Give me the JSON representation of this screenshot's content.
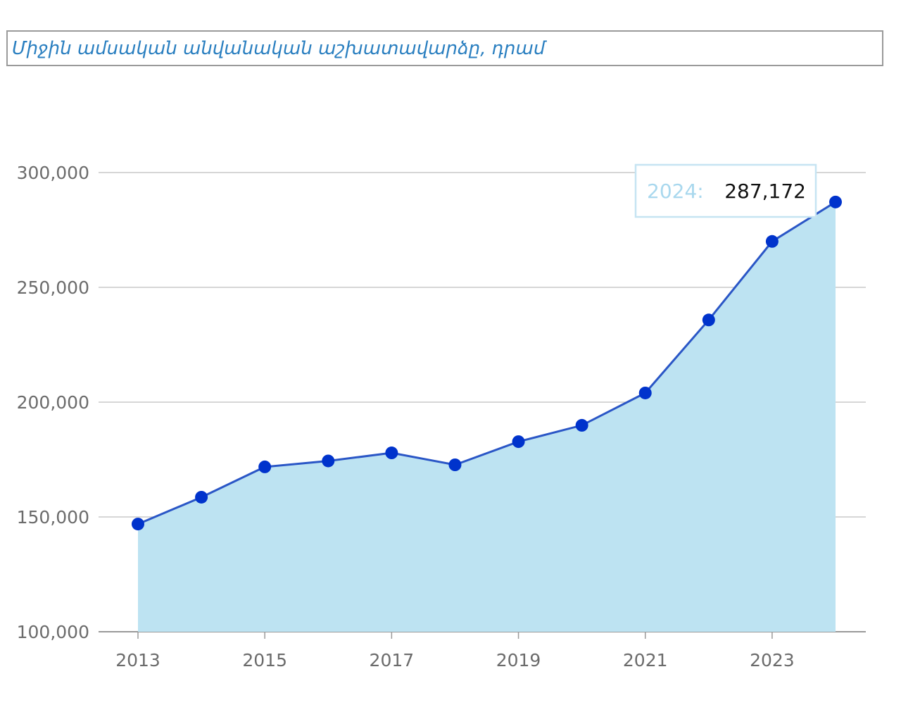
{
  "title": "Միջին ամսական անվանական աշխատավարձը, դրամ",
  "chart_data": {
    "type": "area",
    "title": "Միջին ամսական անվանական աշխատավարձը, դրամ",
    "x": [
      2013,
      2014,
      2015,
      2016,
      2017,
      2018,
      2019,
      2020,
      2021,
      2022,
      2023,
      2024
    ],
    "values": [
      146900,
      158600,
      171800,
      174400,
      177900,
      172700,
      182800,
      189900,
      204000,
      235800,
      270000,
      287172
    ],
    "x_tick_labels": [
      "2013",
      "2015",
      "2017",
      "2019",
      "2021",
      "2023"
    ],
    "y_tick_labels": [
      "100,000",
      "150,000",
      "200,000",
      "250,000",
      "300,000"
    ],
    "y_ticks": [
      100000,
      150000,
      200000,
      250000,
      300000
    ],
    "ylim": [
      100000,
      300000
    ],
    "xlim": [
      2013,
      2024
    ],
    "grid": true,
    "colors": {
      "line": "#2a56c6",
      "marker": "#0033cc",
      "fill": "#bde3f2",
      "grid": "#c8c8c8",
      "axis": "#9a9a9a"
    },
    "tooltip": {
      "year_label": "2024:",
      "value_label": "287,172"
    }
  }
}
